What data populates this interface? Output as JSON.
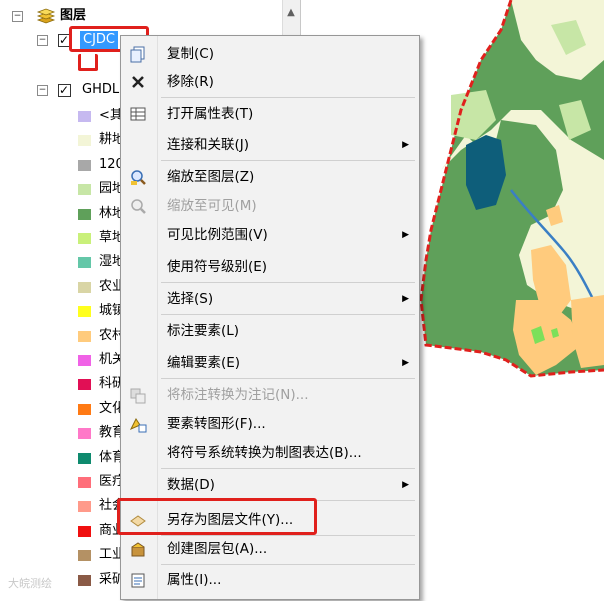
{
  "toc": {
    "root_label": "图层",
    "layer1_label": "CJDC",
    "layer2_label": "GHDL",
    "legend": [
      {
        "label": "<其",
        "color": "#c6b9f0"
      },
      {
        "label": "耕地",
        "color": "#f3f5d7"
      },
      {
        "label": "120",
        "color": "#a8a8a8"
      },
      {
        "label": "园地",
        "color": "#c7e6a6"
      },
      {
        "label": "林地",
        "color": "#5fa05a"
      },
      {
        "label": "草地",
        "color": "#c9f07a"
      },
      {
        "label": "湿地",
        "color": "#64c7a8"
      },
      {
        "label": "农业",
        "color": "#d9d5a5"
      },
      {
        "label": "城镇",
        "color": "#ffff1e"
      },
      {
        "label": "农村",
        "color": "#ffcb7d"
      },
      {
        "label": "机关",
        "color": "#f062e6"
      },
      {
        "label": "科研",
        "color": "#e10f55"
      },
      {
        "label": "文化",
        "color": "#ff7a14"
      },
      {
        "label": "教育",
        "color": "#ff78c8"
      },
      {
        "label": "体育",
        "color": "#0e8a6e"
      },
      {
        "label": "医疗",
        "color": "#ff6e7a"
      },
      {
        "label": "社会",
        "color": "#ff9a8a"
      },
      {
        "label": "商业",
        "color": "#f00f0f"
      },
      {
        "label": "工业",
        "color": "#b49164"
      },
      {
        "label": "采矿",
        "color": "#8a5a46"
      }
    ]
  },
  "menu": {
    "items": [
      {
        "label": "复制(C)",
        "icon": "copy-icon",
        "disabled": false,
        "submenu": false
      },
      {
        "label": "移除(R)",
        "icon": "remove-icon",
        "disabled": false,
        "submenu": false
      },
      {
        "label": "打开属性表(T)",
        "icon": "table-icon",
        "disabled": false,
        "submenu": false
      },
      {
        "label": "连接和关联(J)",
        "icon": "",
        "disabled": false,
        "submenu": true
      },
      {
        "label": "缩放至图层(Z)",
        "icon": "zoom-layer-icon",
        "disabled": false,
        "submenu": false
      },
      {
        "label": "缩放至可见(M)",
        "icon": "zoom-visible-icon",
        "disabled": true,
        "submenu": false
      },
      {
        "label": "可见比例范围(V)",
        "icon": "",
        "disabled": false,
        "submenu": true
      },
      {
        "label": "使用符号级别(E)",
        "icon": "",
        "disabled": false,
        "submenu": false
      },
      {
        "label": "选择(S)",
        "icon": "",
        "disabled": false,
        "submenu": true
      },
      {
        "label": "标注要素(L)",
        "icon": "",
        "disabled": false,
        "submenu": false
      },
      {
        "label": "编辑要素(E)",
        "icon": "",
        "disabled": false,
        "submenu": true
      },
      {
        "label": "将标注转换为注记(N)...",
        "icon": "convert-annotation-icon",
        "disabled": true,
        "submenu": false
      },
      {
        "label": "要素转图形(F)...",
        "icon": "features-to-graphics-icon",
        "disabled": false,
        "submenu": false
      },
      {
        "label": "将符号系统转换为制图表达(B)...",
        "icon": "",
        "disabled": false,
        "submenu": false
      },
      {
        "label": "数据(D)",
        "icon": "",
        "disabled": false,
        "submenu": true
      },
      {
        "label": "另存为图层文件(Y)...",
        "icon": "save-layer-file-icon",
        "disabled": false,
        "submenu": false
      },
      {
        "label": "创建图层包(A)...",
        "icon": "layer-package-icon",
        "disabled": false,
        "submenu": false
      },
      {
        "label": "属性(I)...",
        "icon": "properties-icon",
        "disabled": false,
        "submenu": false
      }
    ]
  },
  "watermark": "大皖测绘",
  "colors": {
    "highlight": "#e0201c",
    "selection": "#3399ff"
  }
}
